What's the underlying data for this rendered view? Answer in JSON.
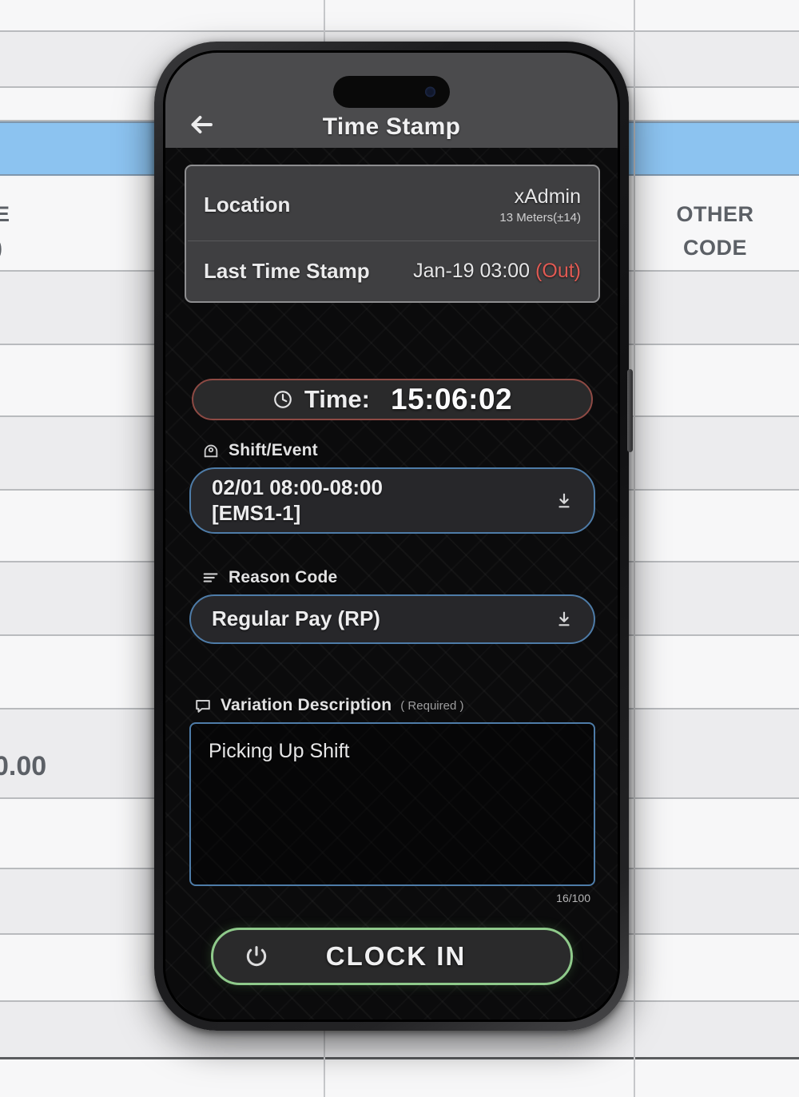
{
  "background": {
    "column_header": "OTHER\nCODE",
    "column_header_line1": "OTHER",
    "column_header_line2": "CODE",
    "left_clipped_header_line1": "E",
    "left_clipped_header_line2": ")",
    "left_value": "0.00"
  },
  "phone": {
    "nav": {
      "title": "Time Stamp",
      "back_icon": "back-arrow-icon"
    },
    "info_card": {
      "rows": [
        {
          "label": "Location",
          "value": "xAdmin",
          "sub": "13 Meters(±14)"
        },
        {
          "label": "Last Time Stamp",
          "value": "Jan-19 03:00 ",
          "status": "(Out)"
        }
      ]
    },
    "time": {
      "icon": "clock-icon",
      "label": "Time:",
      "value": "15:06:02",
      "border_color": "#8e4a44"
    },
    "shift": {
      "icon": "shift-icon",
      "label": "Shift/Event",
      "value": "02/01 08:00-08:00 [EMS1-1]",
      "value_line1": "02/01 08:00-08:00",
      "value_line2": "[EMS1-1]",
      "dropdown_icon": "arrow-down-to-line-icon"
    },
    "reason": {
      "icon": "list-icon",
      "label": "Reason Code",
      "value": "Regular Pay (RP)",
      "dropdown_icon": "arrow-down-to-line-icon"
    },
    "variation": {
      "icon": "comment-icon",
      "label": "Variation Description",
      "required_note": "( Required )",
      "value": "Picking Up Shift",
      "char_count": "16/100"
    },
    "action": {
      "icon": "power-icon",
      "label": "CLOCK IN",
      "border_color": "#8fca8b"
    }
  },
  "colors": {
    "accent_blue": "#4e7ca8",
    "accent_green": "#8fca8b",
    "accent_red": "#8e4a44",
    "status_red": "#e05a53",
    "selected_row": "#8cc3f0"
  }
}
